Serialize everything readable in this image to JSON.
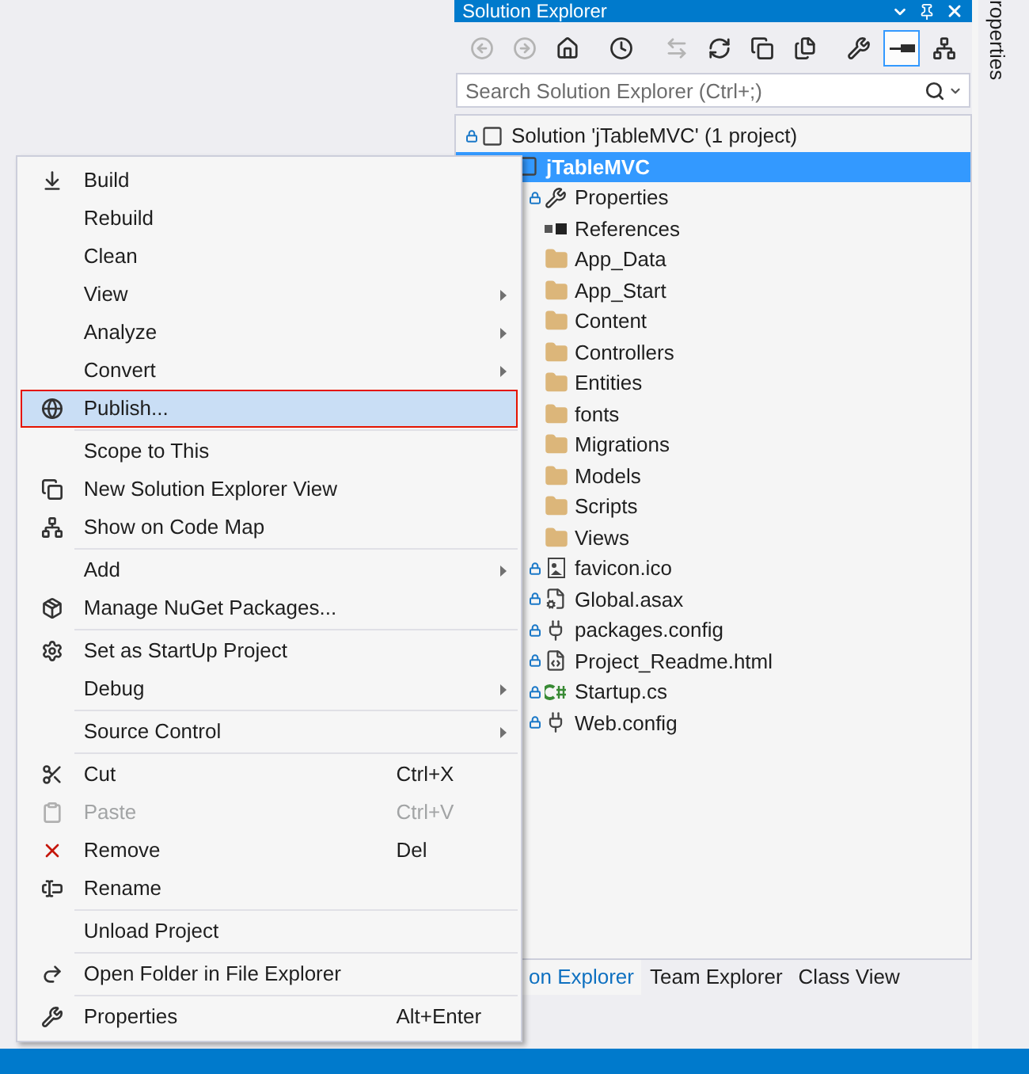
{
  "panel": {
    "title": "Solution Explorer",
    "search": {
      "placeholder": "Search Solution Explorer (Ctrl+;)"
    },
    "toolbar": [
      {
        "kind": "back",
        "disabled": true
      },
      {
        "kind": "forward",
        "disabled": true
      },
      {
        "kind": "home",
        "disabled": false,
        "selected": false
      },
      {
        "kind": "pending",
        "disabled": false,
        "selected": false
      },
      {
        "kind": "sync",
        "disabled": true
      },
      {
        "kind": "refresh",
        "disabled": false,
        "selected": false
      },
      {
        "kind": "collapse",
        "disabled": false,
        "selected": false
      },
      {
        "kind": "showall",
        "disabled": false,
        "selected": false
      },
      {
        "kind": "properties",
        "disabled": false,
        "selected": false
      },
      {
        "kind": "preview",
        "disabled": false,
        "selected": true
      },
      {
        "kind": "codemap",
        "disabled": false,
        "selected": false
      }
    ],
    "tree": [
      {
        "label": "Solution 'jTableMVC' (1 project)",
        "kind": "solution",
        "locked": true,
        "selected": false,
        "children": [
          {
            "label": "jTableMVC",
            "kind": "project",
            "selected": true,
            "children": [
              {
                "label": "Properties",
                "kind": "properties",
                "locked": true,
                "selected": false
              },
              {
                "label": "References",
                "kind": "references",
                "locked": false,
                "selected": false
              },
              {
                "label": "App_Data",
                "kind": "folder",
                "locked": false,
                "selected": false
              },
              {
                "label": "App_Start",
                "kind": "folder",
                "locked": false,
                "selected": false
              },
              {
                "label": "Content",
                "kind": "folder",
                "locked": false,
                "selected": false
              },
              {
                "label": "Controllers",
                "kind": "folder",
                "locked": false,
                "selected": false
              },
              {
                "label": "Entities",
                "kind": "folder",
                "locked": false,
                "selected": false
              },
              {
                "label": "fonts",
                "kind": "folder",
                "locked": false,
                "selected": false
              },
              {
                "label": "Migrations",
                "kind": "folder",
                "locked": false,
                "selected": false
              },
              {
                "label": "Models",
                "kind": "folder",
                "locked": false,
                "selected": false
              },
              {
                "label": "Scripts",
                "kind": "folder",
                "locked": false,
                "selected": false
              },
              {
                "label": "Views",
                "kind": "folder",
                "locked": false,
                "selected": false
              },
              {
                "label": "favicon.ico",
                "kind": "image",
                "locked": true,
                "selected": false
              },
              {
                "label": "Global.asax",
                "kind": "asax",
                "locked": true,
                "selected": false
              },
              {
                "label": "packages.config",
                "kind": "config",
                "locked": true,
                "selected": false
              },
              {
                "label": "Project_Readme.html",
                "kind": "html",
                "locked": true,
                "selected": false
              },
              {
                "label": "Startup.cs",
                "kind": "csharp",
                "locked": true,
                "selected": false
              },
              {
                "label": "Web.config",
                "kind": "config",
                "locked": true,
                "selected": false
              }
            ]
          }
        ]
      }
    ],
    "tabs": [
      {
        "label": "on Explorer",
        "selected": true
      },
      {
        "label": "Team Explorer",
        "selected": false
      },
      {
        "label": "Class View",
        "selected": false
      }
    ]
  },
  "side_tab": {
    "label": "roperties"
  },
  "context_menu": [
    {
      "label": "Build",
      "submenu": false,
      "disabled": false,
      "selected": false,
      "separator_before": false
    },
    {
      "label": "Rebuild",
      "submenu": false,
      "disabled": false,
      "selected": false,
      "separator_before": false
    },
    {
      "label": "Clean",
      "submenu": false,
      "disabled": false,
      "selected": false,
      "separator_before": false
    },
    {
      "label": "View",
      "submenu": true,
      "disabled": false,
      "selected": false,
      "separator_before": false
    },
    {
      "label": "Analyze",
      "submenu": true,
      "disabled": false,
      "selected": false,
      "separator_before": false
    },
    {
      "label": "Convert",
      "submenu": true,
      "disabled": false,
      "selected": false,
      "separator_before": false
    },
    {
      "label": "Publish...",
      "submenu": false,
      "disabled": false,
      "selected": true,
      "separator_before": false
    },
    {
      "label": "Scope to This",
      "submenu": false,
      "disabled": false,
      "selected": false,
      "separator_before": true
    },
    {
      "label": "New Solution Explorer View",
      "submenu": false,
      "disabled": false,
      "selected": false,
      "separator_before": false
    },
    {
      "label": "Show on Code Map",
      "submenu": false,
      "disabled": false,
      "selected": false,
      "separator_before": false
    },
    {
      "label": "Add",
      "submenu": true,
      "disabled": false,
      "selected": false,
      "separator_before": true
    },
    {
      "label": "Manage NuGet Packages...",
      "submenu": false,
      "disabled": false,
      "selected": false,
      "separator_before": false
    },
    {
      "label": "Set as StartUp Project",
      "submenu": false,
      "disabled": false,
      "selected": false,
      "separator_before": true
    },
    {
      "label": "Debug",
      "submenu": true,
      "disabled": false,
      "selected": false,
      "separator_before": false
    },
    {
      "label": "Source Control",
      "submenu": true,
      "disabled": false,
      "selected": false,
      "separator_before": true
    },
    {
      "label": "Cut",
      "shortcut": "Ctrl+X",
      "submenu": false,
      "disabled": false,
      "selected": false,
      "separator_before": true
    },
    {
      "label": "Paste",
      "shortcut": "Ctrl+V",
      "submenu": false,
      "disabled": true,
      "selected": false,
      "separator_before": false
    },
    {
      "label": "Remove",
      "shortcut": "Del",
      "submenu": false,
      "disabled": false,
      "selected": false,
      "separator_before": false
    },
    {
      "label": "Rename",
      "submenu": false,
      "disabled": false,
      "selected": false,
      "separator_before": false
    },
    {
      "label": "Unload Project",
      "submenu": false,
      "disabled": false,
      "selected": false,
      "separator_before": true
    },
    {
      "label": "Open Folder in File Explorer",
      "submenu": false,
      "disabled": false,
      "selected": false,
      "separator_before": true
    },
    {
      "label": "Properties",
      "shortcut": "Alt+Enter",
      "submenu": false,
      "disabled": false,
      "selected": false,
      "separator_before": true
    }
  ]
}
